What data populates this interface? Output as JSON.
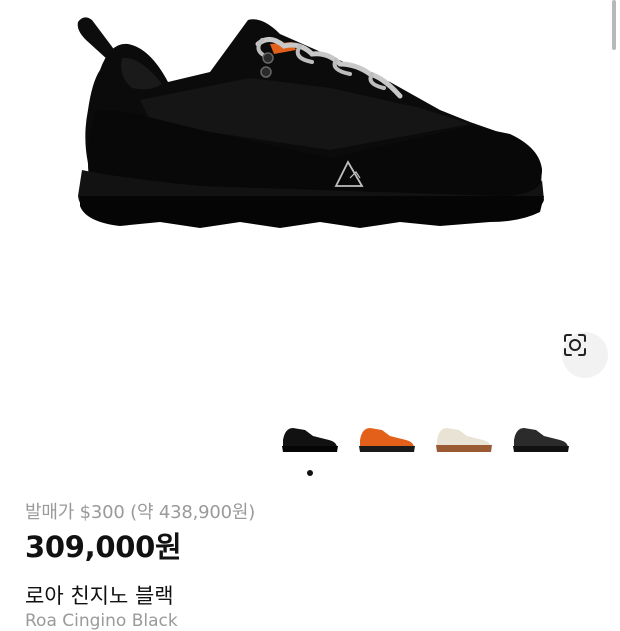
{
  "product": {
    "release_price_text": "발매가 $300 (약 438,900원)",
    "price": "309,000원",
    "name_ko": "로아 친지노 블랙",
    "name_en": "Roa Cingino Black"
  },
  "gallery": {
    "current_index": 0,
    "image_count": 1,
    "thumbnails": [
      {
        "color": "black",
        "selected": true
      },
      {
        "color": "orange",
        "selected": false
      },
      {
        "color": "cream-brown",
        "selected": false
      },
      {
        "color": "dark-grey",
        "selected": false
      }
    ]
  },
  "colors": {
    "text_primary": "#111111",
    "text_secondary": "#9a9a9a",
    "shoe_black": "#0b0b0b",
    "accent_orange": "#e2601a"
  },
  "icons": {
    "lens": "visual-search-icon"
  }
}
